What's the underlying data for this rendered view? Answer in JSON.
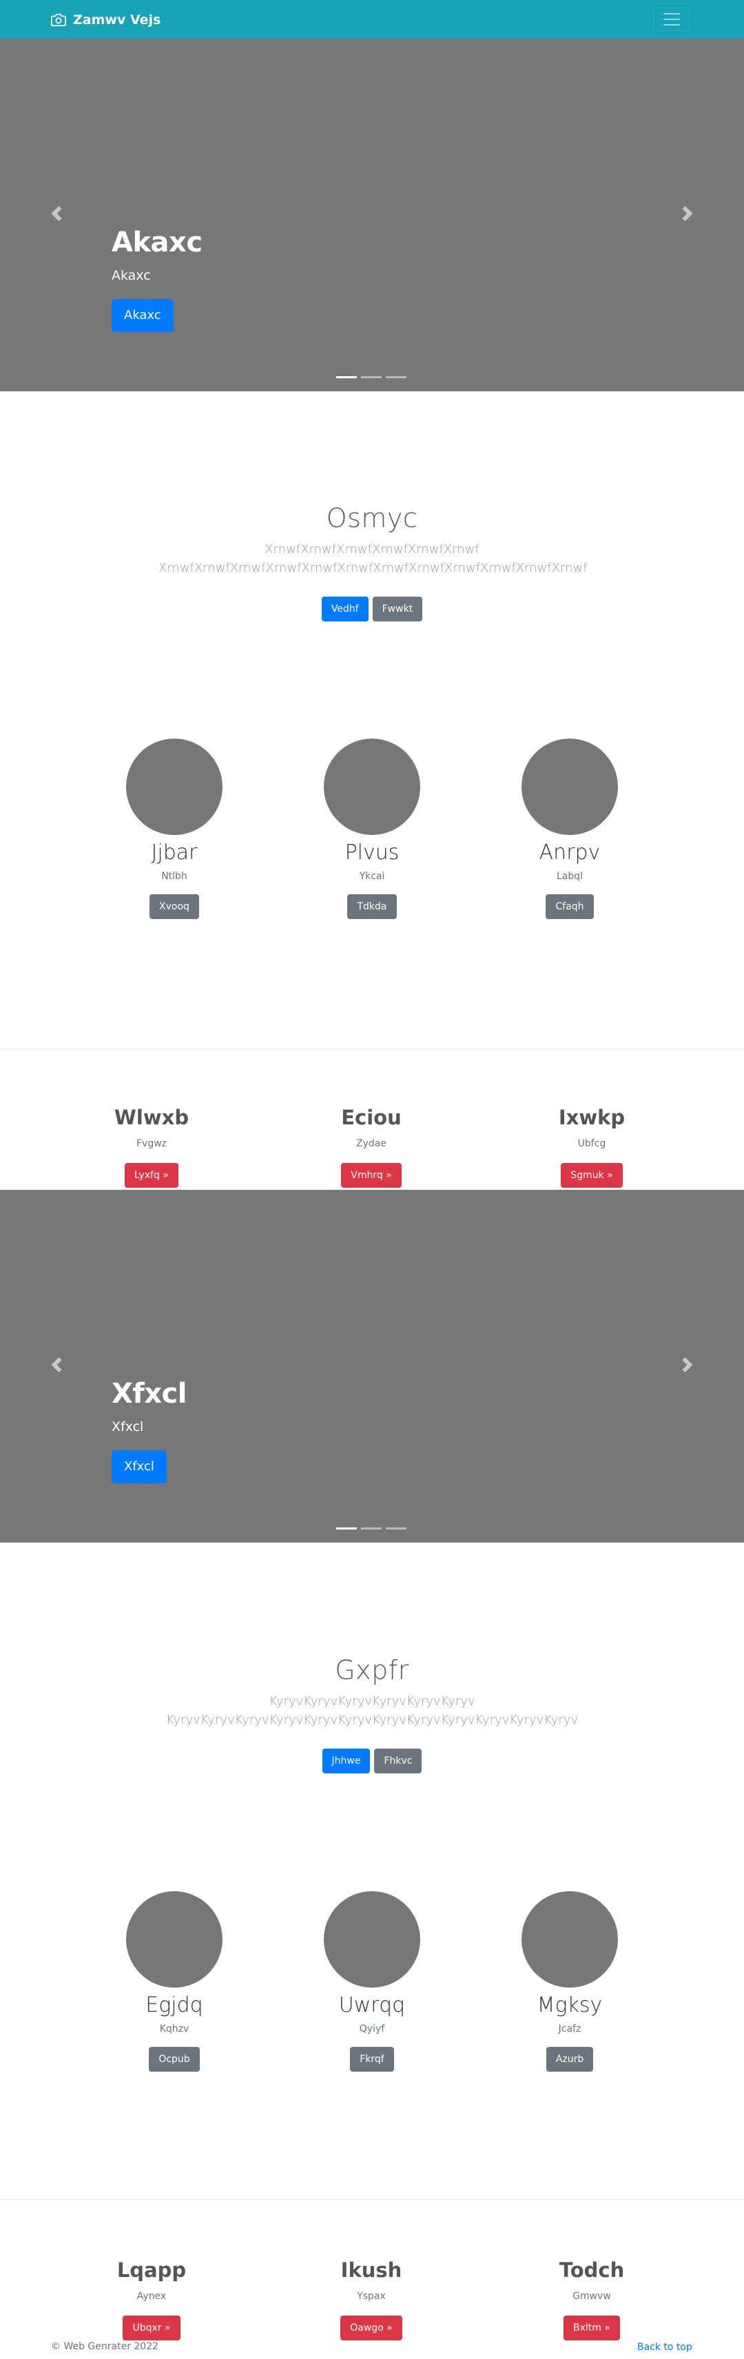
{
  "navbar": {
    "brand": "Zamwv Vejs",
    "brand_icon": "camera-icon",
    "toggler_icon": "hamburger-menu-icon",
    "background": "#17a2b8"
  },
  "carousel1": {
    "title": "Akaxc",
    "subtitle": "Akaxc",
    "button": "Akaxc",
    "prev_icon": "chevron-left-icon",
    "next_icon": "chevron-right-icon",
    "slides": 3,
    "active_slide": 1
  },
  "jumbotron1": {
    "title": "Osmyc",
    "lead": "XrnwfXrnwfXrnwfXrnwfXrnwfXrnwf XrnwfXrnwfXrnwfXrnwfXrnwfXrnwfXrnwfXrnwfXrnwfXrnwfXrnwfXrnwf",
    "primary_button": "Vedhf",
    "secondary_button": "Fwwkt"
  },
  "profiles1": [
    {
      "name": "Jjbar",
      "sub": "Ntlbh",
      "button": "Xvooq"
    },
    {
      "name": "Plvus",
      "sub": "Ykcai",
      "button": "Tdkda"
    },
    {
      "name": "Anrpv",
      "sub": "Labql",
      "button": "Cfaqh"
    }
  ],
  "features1": [
    {
      "name": "Wlwxb",
      "sub": "Fvgwz",
      "button": "Lyxfq »"
    },
    {
      "name": "Eciou",
      "sub": "Zydae",
      "button": "Vmhrq »"
    },
    {
      "name": "Ixwkp",
      "sub": "Ubfcg",
      "button": "Sgmuk »"
    }
  ],
  "carousel2": {
    "title": "Xfxcl",
    "subtitle": "Xfxcl",
    "button": "Xfxcl",
    "prev_icon": "chevron-left-icon",
    "next_icon": "chevron-right-icon",
    "slides": 3,
    "active_slide": 1
  },
  "jumbotron2": {
    "title": "Gxpfr",
    "lead": "KyryvKyryvKyryvKyryvKyryvKyryv KyryvKyryvKyryvKyryvKyryvKyryvKyryvKyryvKyryvKyryvKyryvKyryv",
    "primary_button": "Jhhwe",
    "secondary_button": "Fhkvc"
  },
  "profiles2": [
    {
      "name": "Egjdq",
      "sub": "Kqhzv",
      "button": "Ocpub"
    },
    {
      "name": "Uwrqq",
      "sub": "Qyiyf",
      "button": "Fkrqf"
    },
    {
      "name": "Mgksy",
      "sub": "Jcafz",
      "button": "Azurb"
    }
  ],
  "features2": [
    {
      "name": "Lqapp",
      "sub": "Aynex",
      "button": "Ubqxr »"
    },
    {
      "name": "Ikush",
      "sub": "Yspax",
      "button": "Oawgo »"
    },
    {
      "name": "Todch",
      "sub": "Gmwvw",
      "button": "Bxltm »"
    }
  ],
  "footer": {
    "copyright": "© Web Genrater 2022",
    "back_to_top": "Back to top"
  },
  "colors": {
    "navbar": "#17a2b8",
    "carousel_bg": "#777777",
    "primary": "#007bff",
    "secondary": "#6c757d",
    "danger": "#dc3545"
  }
}
